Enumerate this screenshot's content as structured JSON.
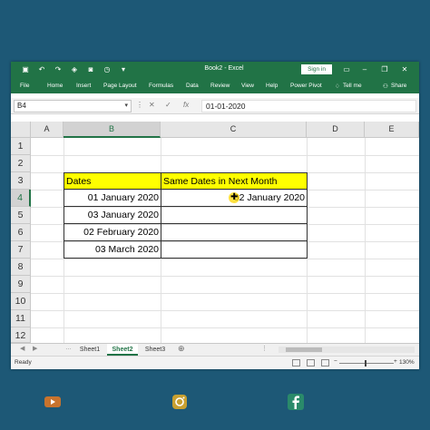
{
  "colors": {
    "excel_green": "#217346",
    "header_fill": "#ffff00",
    "background": "#1d5876"
  },
  "window": {
    "title": "Book2 - Excel",
    "sign_in": "Sign in"
  },
  "ribbon": {
    "tabs": [
      "File",
      "Home",
      "Insert",
      "Page Layout",
      "Formulas",
      "Data",
      "Review",
      "View",
      "Help",
      "Power Pivot",
      "Tell me",
      "Share"
    ]
  },
  "formula_bar": {
    "name_box": "B4",
    "fx": "fx",
    "value": "01-01-2020"
  },
  "grid": {
    "columns": [
      "A",
      "B",
      "C",
      "D",
      "E"
    ],
    "rows": [
      "1",
      "2",
      "3",
      "4",
      "5",
      "6",
      "7",
      "8",
      "9",
      "10",
      "11",
      "12"
    ],
    "table": {
      "headers": [
        "Dates",
        "Same Dates in Next Month"
      ],
      "rows": [
        [
          "01 January 2020",
          "02 January 2020"
        ],
        [
          "03 January 2020",
          ""
        ],
        [
          "02 February 2020",
          ""
        ],
        [
          "03 March 2020",
          ""
        ]
      ]
    }
  },
  "sheets": {
    "tabs": [
      "Sheet1",
      "Sheet2",
      "Sheet3"
    ],
    "active": "Sheet2"
  },
  "status": {
    "ready": "Ready",
    "zoom": "130%"
  },
  "social": [
    "youtube-icon",
    "instagram-icon",
    "facebook-icon"
  ]
}
